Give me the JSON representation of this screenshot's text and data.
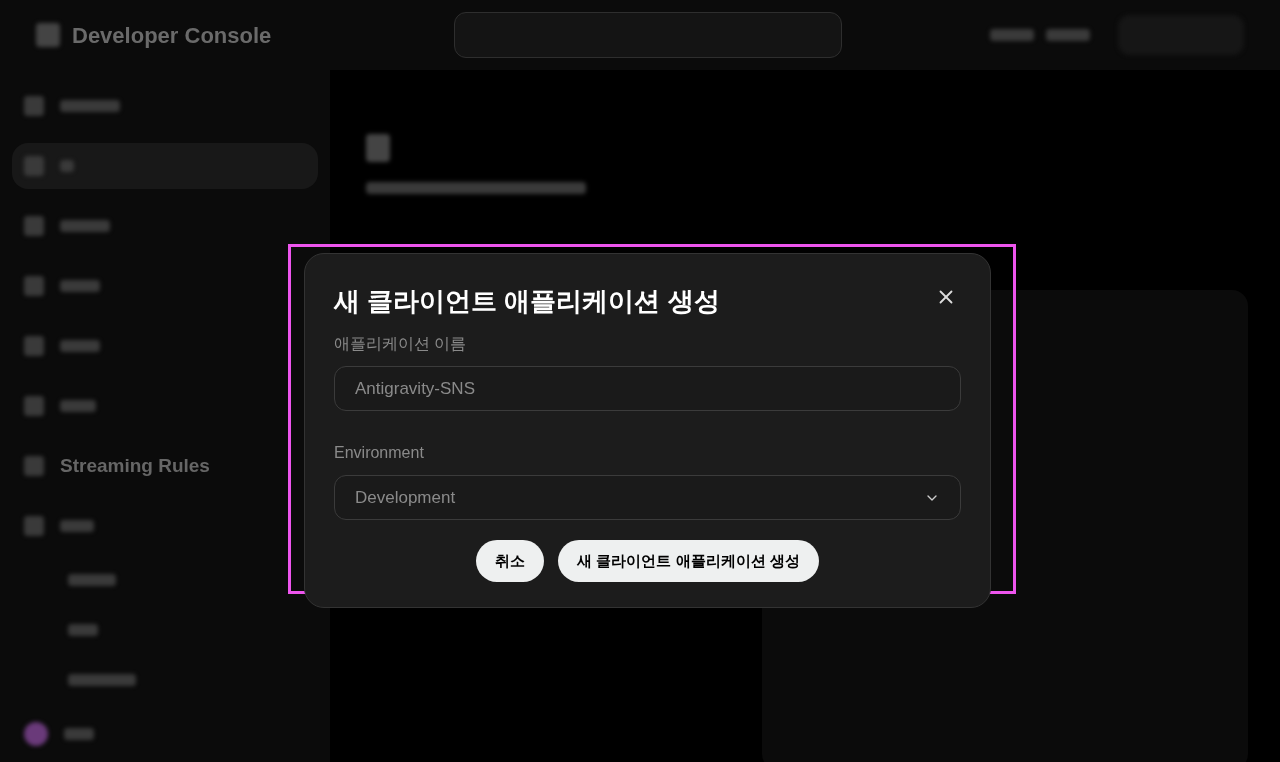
{
  "background": {
    "brand": "Developer Console",
    "sidebar_item": "Streaming Rules"
  },
  "dialog": {
    "title": "새 클라이언트 애플리케이션 생성",
    "fields": [
      {
        "kind": "text",
        "label": "애플리케이션 이름",
        "placeholder": "Antigravity-SNS"
      },
      {
        "kind": "select",
        "label": "Environment",
        "value": "Development"
      }
    ],
    "buttons": [
      "취소",
      "새 클라이언트 애플리케이션 생성"
    ]
  }
}
